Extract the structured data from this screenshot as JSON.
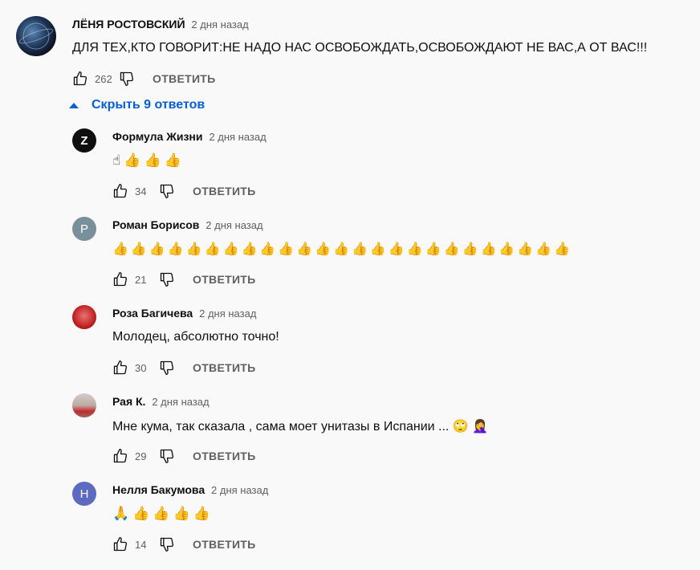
{
  "main_comment": {
    "author": "ЛЁНЯ РОСТОВСКИЙ",
    "time": "2 дня назад",
    "text": "ДЛЯ ТЕХ,КТО ГОВОРИТ:НЕ НАДО НАС ОСВОБОЖДАТЬ,ОСВОБОЖДАЮТ НЕ ВАС,А ОТ ВАС!!!",
    "likes": "262",
    "reply_label": "ОТВЕТИТЬ"
  },
  "replies_toggle": {
    "label": "Скрыть 9 ответов",
    "icon": "triangle-up-icon",
    "color": "#065fd4"
  },
  "replies": [
    {
      "author": "Формула Жизни",
      "time": "2 дня назад",
      "emoji": "☝👍👍👍",
      "likes": "34",
      "reply_label": "ОТВЕТИТЬ",
      "avatar_letter": "Z",
      "avatar_color": "#0f0f0f"
    },
    {
      "author": "Роман Борисов",
      "time": "2 дня назад",
      "emoji": "👍👍👍👍👍👍👍👍👍👍👍👍👍👍👍👍👍👍👍👍👍👍👍👍👍",
      "likes": "21",
      "reply_label": "ОТВЕТИТЬ",
      "avatar_letter": "P",
      "avatar_color": "#78909c"
    },
    {
      "author": "Роза Багичева",
      "time": "2 дня назад",
      "text": "Молодец, абсолютно точно!",
      "likes": "30",
      "reply_label": "ОТВЕТИТЬ",
      "avatar_color": "#b71c1c"
    },
    {
      "author": "Рая К.",
      "time": "2 дня назад",
      "text": "Мне кума, так сказала , сама моет унитазы в Испании ...",
      "emoji": "🙄 🤦‍♀️",
      "likes": "29",
      "reply_label": "ОТВЕТИТЬ",
      "avatar_color": "#b0a39a"
    },
    {
      "author": "Нелля Бакумова",
      "time": "2 дня назад",
      "emoji": "🙏👍👍👍👍",
      "likes": "14",
      "reply_label": "ОТВЕТИТЬ",
      "avatar_letter": "H",
      "avatar_color": "#5c6bc0"
    }
  ]
}
